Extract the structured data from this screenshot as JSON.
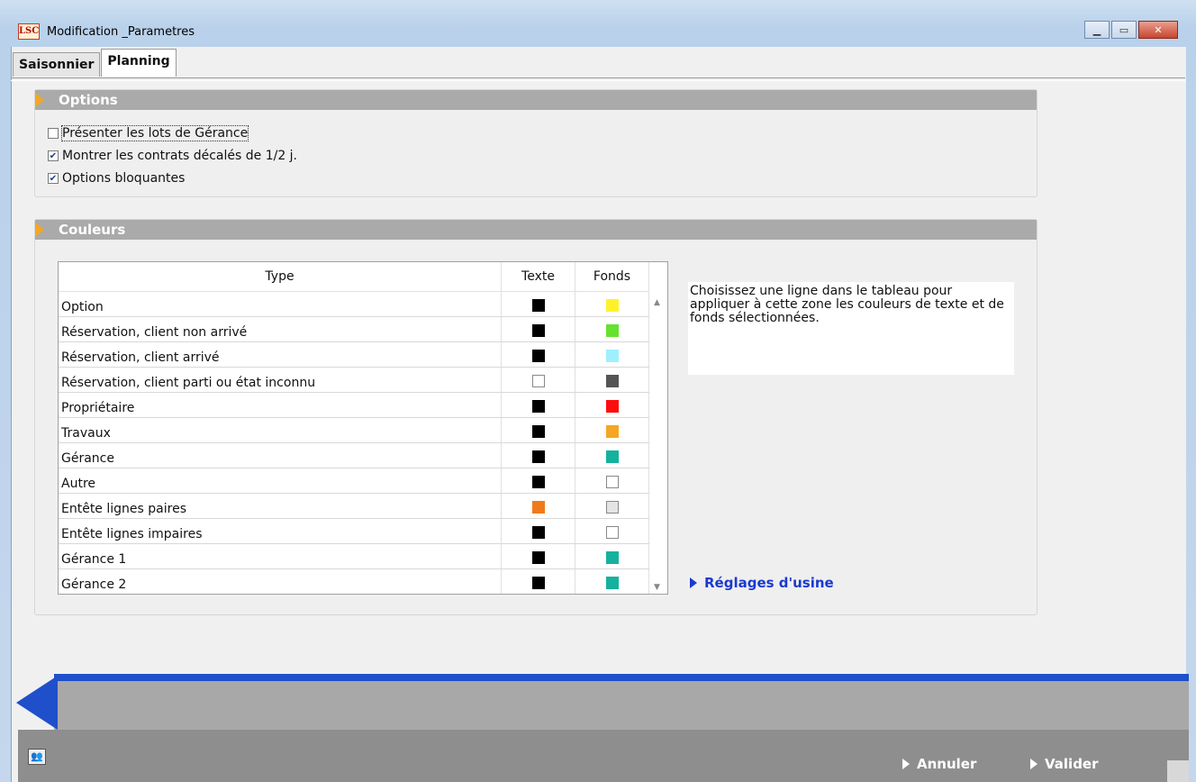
{
  "window": {
    "title": "Modification _Parametres",
    "icon_text": "LSC"
  },
  "tabs": [
    {
      "label": "Saisonnier",
      "active": false
    },
    {
      "label": "Planning",
      "active": true
    }
  ],
  "options": {
    "header": "Options",
    "checkboxes": [
      {
        "label": "Présenter les lots de Gérance",
        "checked": false
      },
      {
        "label": "Montrer les contrats décalés de 1/2 j.",
        "checked": true
      },
      {
        "label": "Options bloquantes",
        "checked": true
      }
    ]
  },
  "colors": {
    "header": "Couleurs",
    "columns": {
      "type": "Type",
      "texte": "Texte",
      "fonds": "Fonds"
    },
    "rows": [
      {
        "type": "Option",
        "texte": "#000000",
        "fonds": "#fff22a"
      },
      {
        "type": "Réservation, client non arrivé",
        "texte": "#000000",
        "fonds": "#66e22e"
      },
      {
        "type": "Réservation, client arrivé",
        "texte": "#000000",
        "fonds": "#9ef0ff"
      },
      {
        "type": "Réservation, client parti ou état inconnu",
        "texte": "#ffffff",
        "fonds": "#555555"
      },
      {
        "type": "Propriétaire",
        "texte": "#000000",
        "fonds": "#ff0d0d"
      },
      {
        "type": "Travaux",
        "texte": "#000000",
        "fonds": "#f5a623"
      },
      {
        "type": "Gérance",
        "texte": "#000000",
        "fonds": "#14b29e"
      },
      {
        "type": "Autre",
        "texte": "#000000",
        "fonds": "#ffffff"
      },
      {
        "type": "Entête lignes paires",
        "texte": "#f07a1a",
        "fonds": "#e4e4e4"
      },
      {
        "type": "Entête lignes impaires",
        "texte": "#000000",
        "fonds": "#ffffff"
      },
      {
        "type": "Gérance 1",
        "texte": "#000000",
        "fonds": "#14b29e"
      },
      {
        "type": "Gérance 2",
        "texte": "#000000",
        "fonds": "#14b29e"
      }
    ],
    "help_text": "Choisissez une ligne dans le tableau pour appliquer à cette zone les couleurs de texte et de fonds sélectionnées.",
    "reset_label": "Réglages d'usine"
  },
  "footer": {
    "cancel_label": "Annuler",
    "validate_label": "Valider"
  },
  "theme": {
    "section_header_bg": "#aaaaaa",
    "accent_orange": "#f5a623",
    "accent_blue": "#1f4fcb",
    "link_blue": "#1a3ad0"
  }
}
